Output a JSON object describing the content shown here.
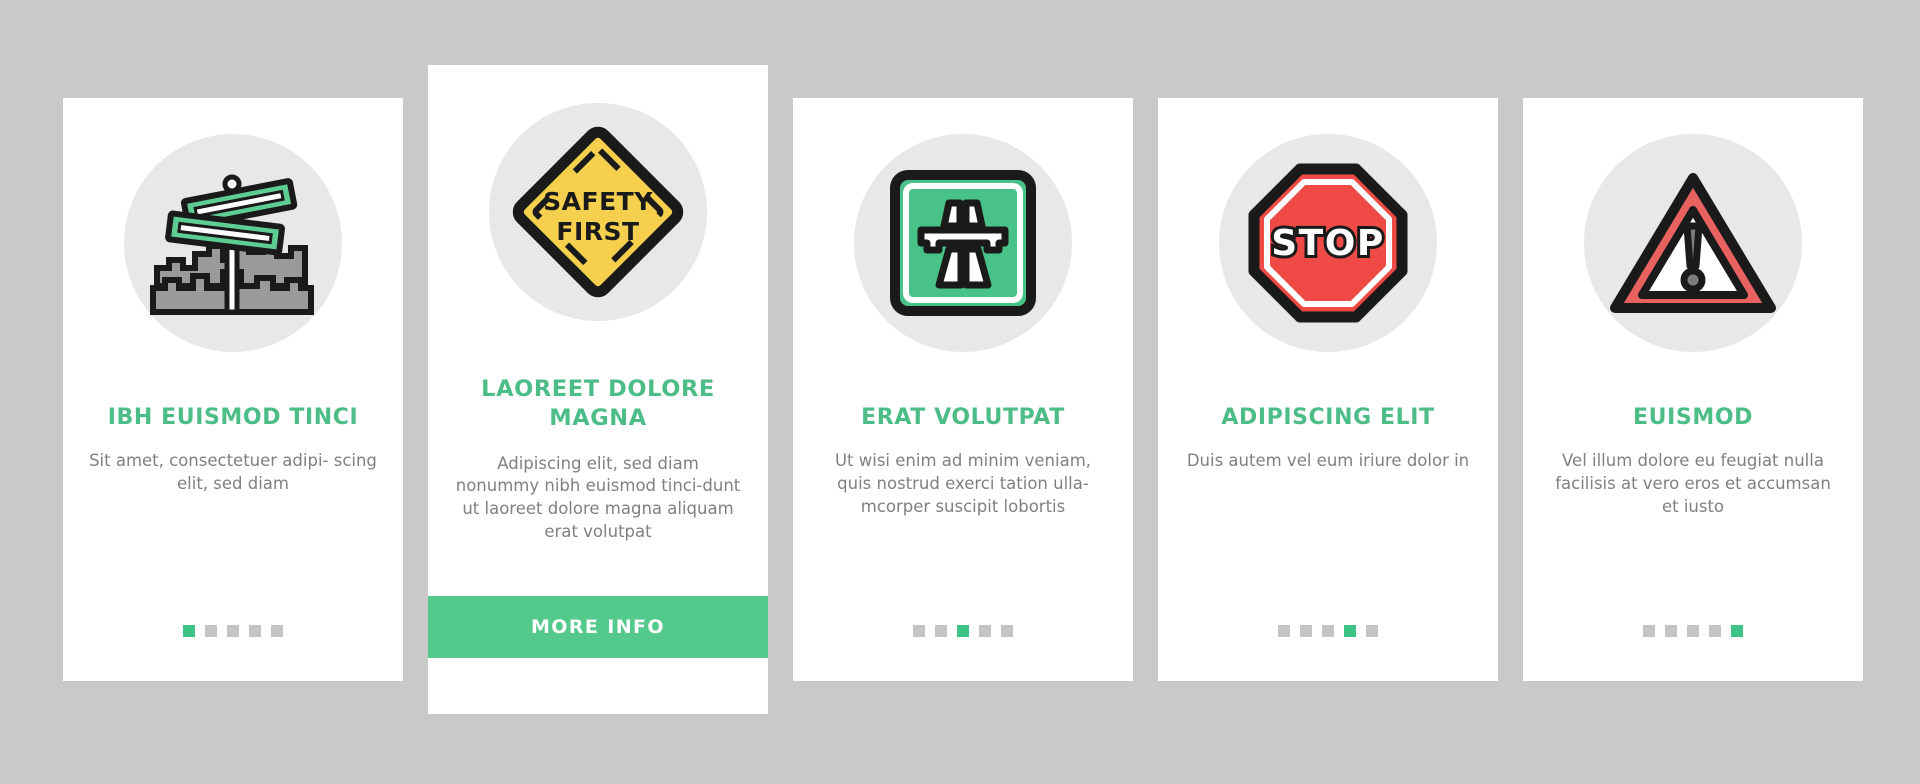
{
  "theme": {
    "background": "#c9c9c9",
    "card_background": "#ffffff",
    "accent_green": "#4cbd87",
    "button_green": "#54c98c",
    "title_color": "#4cbd87",
    "body_text_color": "#808080",
    "icon_circle": "#e8e8e8",
    "dot_inactive": "#c4c4c4",
    "dot_active": "#3ec387",
    "sign_green": "#49c287",
    "sign_yellow": "#f5cf4e",
    "sign_red": "#ef4a46",
    "sign_red_soft": "#e8625f",
    "outline_black": "#1a1a1a",
    "building_gray": "#9a9a9a"
  },
  "cards": [
    {
      "id": "card-1",
      "icon": "crossroad-street-sign-icon",
      "icon_label": "Crossroad street signs over city skyline",
      "title": "IBH EUISMOD TINCI",
      "description": "Sit amet, consectetuer adipi-\nscing elit, sed diam",
      "dots": 5,
      "active_dot": 1,
      "featured": false,
      "button": null
    },
    {
      "id": "card-2",
      "icon": "safety-first-diamond-sign-icon",
      "icon_label": "Yellow diamond sign reading SAFETY FIRST",
      "sign_text_line1": "SAFETY",
      "sign_text_line2": "FIRST",
      "title": "LAOREET DOLORE MAGNA",
      "description": "Adipiscing elit, sed diam nonummy nibh euismod tinci-dunt ut laoreet dolore magna aliquam erat volutpat",
      "dots": 0,
      "active_dot": 0,
      "featured": true,
      "button": "MORE INFO"
    },
    {
      "id": "card-3",
      "icon": "motorway-highway-sign-icon",
      "icon_label": "Green square motorway highway sign",
      "title": "ERAT VOLUTPAT",
      "description": "Ut wisi enim ad minim veniam, quis nostrud exerci tation ulla-mcorper suscipit lobortis",
      "dots": 5,
      "active_dot": 3,
      "featured": false,
      "button": null
    },
    {
      "id": "card-4",
      "icon": "stop-sign-icon",
      "icon_label": "Red octagonal STOP sign",
      "sign_text_line1": "STOP",
      "title": "ADIPISCING ELIT",
      "description": "Duis autem vel eum iriure dolor in",
      "dots": 5,
      "active_dot": 4,
      "featured": false,
      "button": null
    },
    {
      "id": "card-5",
      "icon": "warning-triangle-sign-icon",
      "icon_label": "Red warning triangle with exclamation mark",
      "title": "EUISMOD",
      "description": "Vel illum dolore eu feugiat nulla facilisis at vero eros et accumsan et iusto",
      "dots": 5,
      "active_dot": 5,
      "featured": false,
      "button": null
    }
  ]
}
